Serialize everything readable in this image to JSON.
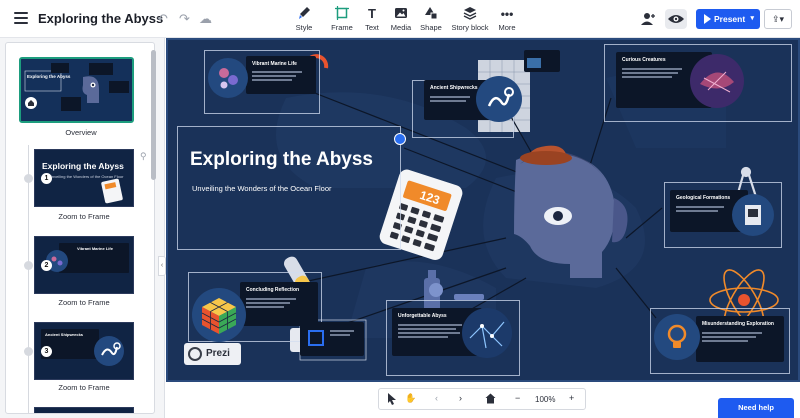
{
  "app": {
    "doc_title": "Exploring the Abyss"
  },
  "toolbar": {
    "tools": [
      {
        "label": "Style",
        "icon": "brush-icon"
      },
      {
        "label": "Frame",
        "icon": "frame-icon"
      },
      {
        "label": "Text",
        "icon": "text-icon"
      },
      {
        "label": "Media",
        "icon": "media-icon"
      },
      {
        "label": "Shape",
        "icon": "shape-icon"
      },
      {
        "label": "Story block",
        "icon": "layers-icon"
      },
      {
        "label": "More",
        "icon": "more-icon"
      }
    ],
    "present_label": "Present"
  },
  "sidebar": {
    "overview_label": "Overview",
    "overview_thumb_title": "Exploring the Abyss",
    "steps": [
      {
        "number": "1",
        "caption": "Zoom to Frame",
        "thumb_title": "Exploring the Abyss",
        "thumb_sub": "Unveiling the Wonders of the Ocean Floor"
      },
      {
        "number": "2",
        "caption": "Zoom to Frame",
        "thumb_title": "Vibrant Marine Life"
      },
      {
        "number": "3",
        "caption": "Zoom to Frame",
        "thumb_title": "Ancient Shipwrecks"
      }
    ]
  },
  "canvas": {
    "title": "Exploring the Abyss",
    "subtitle": "Unveiling the Wonders of the Ocean Floor",
    "cards": {
      "vibrant": "Vibrant Marine Life",
      "shipwrecks": "Ancient Shipwrecks",
      "curious": "Curious Creatures",
      "geological": "Geological Formations",
      "concluding": "Concluding Reflection",
      "unforgettable": "Unforgettable Abyss",
      "misunderstanding": "Misunderstanding Exploration"
    },
    "prezi_label": "Prezi"
  },
  "bottom_bar": {
    "zoom_level": "100%"
  },
  "help": {
    "label": "Need help"
  },
  "colors": {
    "accent": "#1e5bf0",
    "canvas_bg": "#1a3259",
    "selection": "#1d9d7e"
  }
}
